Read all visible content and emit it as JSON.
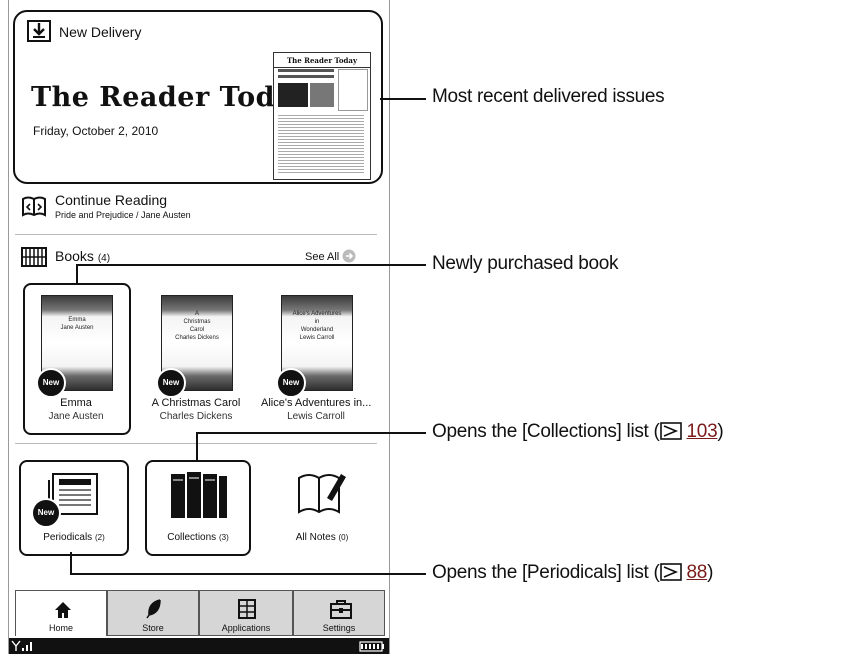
{
  "new_delivery": {
    "title": "New Delivery",
    "masthead": "The Reader Today",
    "date": "Friday, October 2, 2010",
    "thumb_masthead": "The Reader Today"
  },
  "continue_reading": {
    "title": "Continue Reading",
    "subtitle": "Pride and Prejudice / Jane Austen"
  },
  "books": {
    "title": "Books",
    "count": "(4)",
    "see_all": "See All",
    "items": [
      {
        "cover": "Emma\nJane Austen",
        "title": "Emma",
        "author": "Jane Austen",
        "badge": "New"
      },
      {
        "cover": "A\nChristmas\nCarol\nCharles Dickens",
        "title": "A Christmas Carol",
        "author": "Charles Dickens",
        "badge": "New"
      },
      {
        "cover": "Alice's Adventures\nin\nWonderland\nLewis Carroll",
        "title": "Alice's Adventures in...",
        "author": "Lewis Carroll",
        "badge": "New"
      }
    ]
  },
  "tiles": {
    "periodicals": {
      "label": "Periodicals",
      "count": "(2)",
      "badge": "New"
    },
    "collections": {
      "label": "Collections",
      "count": "(3)"
    },
    "notes": {
      "label": "All Notes",
      "count": "(0)"
    }
  },
  "nav": {
    "home": "Home",
    "store": "Store",
    "applications": "Applications",
    "settings": "Settings"
  },
  "callouts": {
    "recent": "Most recent delivered issues",
    "purchased": "Newly purchased book",
    "collections_prefix": "Opens the [Collections] list (",
    "collections_ref": "103",
    "periodicals_prefix": "Opens the [Periodicals] list (",
    "periodicals_ref": "88",
    "suffix": ")"
  },
  "colors": {
    "ref_link": "#7a1a1a",
    "nav_inactive": "#d6d6d6",
    "frame": "#111111"
  }
}
